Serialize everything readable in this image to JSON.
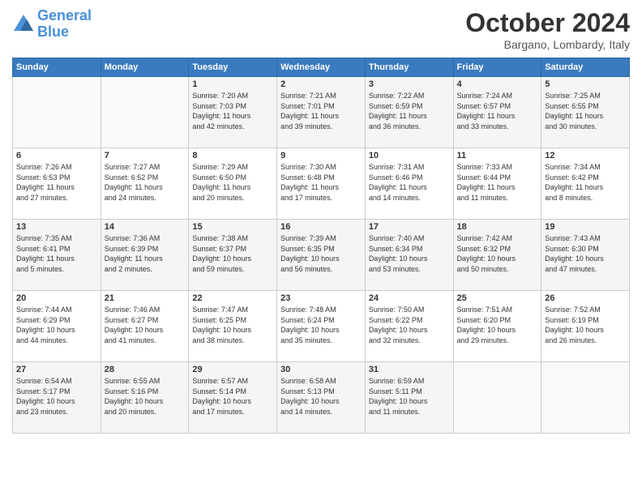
{
  "logo": {
    "line1": "General",
    "line2": "Blue"
  },
  "title": "October 2024",
  "location": "Bargano, Lombardy, Italy",
  "header": {
    "days": [
      "Sunday",
      "Monday",
      "Tuesday",
      "Wednesday",
      "Thursday",
      "Friday",
      "Saturday"
    ]
  },
  "weeks": [
    [
      {
        "day": "",
        "content": ""
      },
      {
        "day": "",
        "content": ""
      },
      {
        "day": "1",
        "content": "Sunrise: 7:20 AM\nSunset: 7:03 PM\nDaylight: 11 hours\nand 42 minutes."
      },
      {
        "day": "2",
        "content": "Sunrise: 7:21 AM\nSunset: 7:01 PM\nDaylight: 11 hours\nand 39 minutes."
      },
      {
        "day": "3",
        "content": "Sunrise: 7:22 AM\nSunset: 6:59 PM\nDaylight: 11 hours\nand 36 minutes."
      },
      {
        "day": "4",
        "content": "Sunrise: 7:24 AM\nSunset: 6:57 PM\nDaylight: 11 hours\nand 33 minutes."
      },
      {
        "day": "5",
        "content": "Sunrise: 7:25 AM\nSunset: 6:55 PM\nDaylight: 11 hours\nand 30 minutes."
      }
    ],
    [
      {
        "day": "6",
        "content": "Sunrise: 7:26 AM\nSunset: 6:53 PM\nDaylight: 11 hours\nand 27 minutes."
      },
      {
        "day": "7",
        "content": "Sunrise: 7:27 AM\nSunset: 6:52 PM\nDaylight: 11 hours\nand 24 minutes."
      },
      {
        "day": "8",
        "content": "Sunrise: 7:29 AM\nSunset: 6:50 PM\nDaylight: 11 hours\nand 20 minutes."
      },
      {
        "day": "9",
        "content": "Sunrise: 7:30 AM\nSunset: 6:48 PM\nDaylight: 11 hours\nand 17 minutes."
      },
      {
        "day": "10",
        "content": "Sunrise: 7:31 AM\nSunset: 6:46 PM\nDaylight: 11 hours\nand 14 minutes."
      },
      {
        "day": "11",
        "content": "Sunrise: 7:33 AM\nSunset: 6:44 PM\nDaylight: 11 hours\nand 11 minutes."
      },
      {
        "day": "12",
        "content": "Sunrise: 7:34 AM\nSunset: 6:42 PM\nDaylight: 11 hours\nand 8 minutes."
      }
    ],
    [
      {
        "day": "13",
        "content": "Sunrise: 7:35 AM\nSunset: 6:41 PM\nDaylight: 11 hours\nand 5 minutes."
      },
      {
        "day": "14",
        "content": "Sunrise: 7:36 AM\nSunset: 6:39 PM\nDaylight: 11 hours\nand 2 minutes."
      },
      {
        "day": "15",
        "content": "Sunrise: 7:38 AM\nSunset: 6:37 PM\nDaylight: 10 hours\nand 59 minutes."
      },
      {
        "day": "16",
        "content": "Sunrise: 7:39 AM\nSunset: 6:35 PM\nDaylight: 10 hours\nand 56 minutes."
      },
      {
        "day": "17",
        "content": "Sunrise: 7:40 AM\nSunset: 6:34 PM\nDaylight: 10 hours\nand 53 minutes."
      },
      {
        "day": "18",
        "content": "Sunrise: 7:42 AM\nSunset: 6:32 PM\nDaylight: 10 hours\nand 50 minutes."
      },
      {
        "day": "19",
        "content": "Sunrise: 7:43 AM\nSunset: 6:30 PM\nDaylight: 10 hours\nand 47 minutes."
      }
    ],
    [
      {
        "day": "20",
        "content": "Sunrise: 7:44 AM\nSunset: 6:29 PM\nDaylight: 10 hours\nand 44 minutes."
      },
      {
        "day": "21",
        "content": "Sunrise: 7:46 AM\nSunset: 6:27 PM\nDaylight: 10 hours\nand 41 minutes."
      },
      {
        "day": "22",
        "content": "Sunrise: 7:47 AM\nSunset: 6:25 PM\nDaylight: 10 hours\nand 38 minutes."
      },
      {
        "day": "23",
        "content": "Sunrise: 7:48 AM\nSunset: 6:24 PM\nDaylight: 10 hours\nand 35 minutes."
      },
      {
        "day": "24",
        "content": "Sunrise: 7:50 AM\nSunset: 6:22 PM\nDaylight: 10 hours\nand 32 minutes."
      },
      {
        "day": "25",
        "content": "Sunrise: 7:51 AM\nSunset: 6:20 PM\nDaylight: 10 hours\nand 29 minutes."
      },
      {
        "day": "26",
        "content": "Sunrise: 7:52 AM\nSunset: 6:19 PM\nDaylight: 10 hours\nand 26 minutes."
      }
    ],
    [
      {
        "day": "27",
        "content": "Sunrise: 6:54 AM\nSunset: 5:17 PM\nDaylight: 10 hours\nand 23 minutes."
      },
      {
        "day": "28",
        "content": "Sunrise: 6:55 AM\nSunset: 5:16 PM\nDaylight: 10 hours\nand 20 minutes."
      },
      {
        "day": "29",
        "content": "Sunrise: 6:57 AM\nSunset: 5:14 PM\nDaylight: 10 hours\nand 17 minutes."
      },
      {
        "day": "30",
        "content": "Sunrise: 6:58 AM\nSunset: 5:13 PM\nDaylight: 10 hours\nand 14 minutes."
      },
      {
        "day": "31",
        "content": "Sunrise: 6:59 AM\nSunset: 5:11 PM\nDaylight: 10 hours\nand 11 minutes."
      },
      {
        "day": "",
        "content": ""
      },
      {
        "day": "",
        "content": ""
      }
    ]
  ]
}
